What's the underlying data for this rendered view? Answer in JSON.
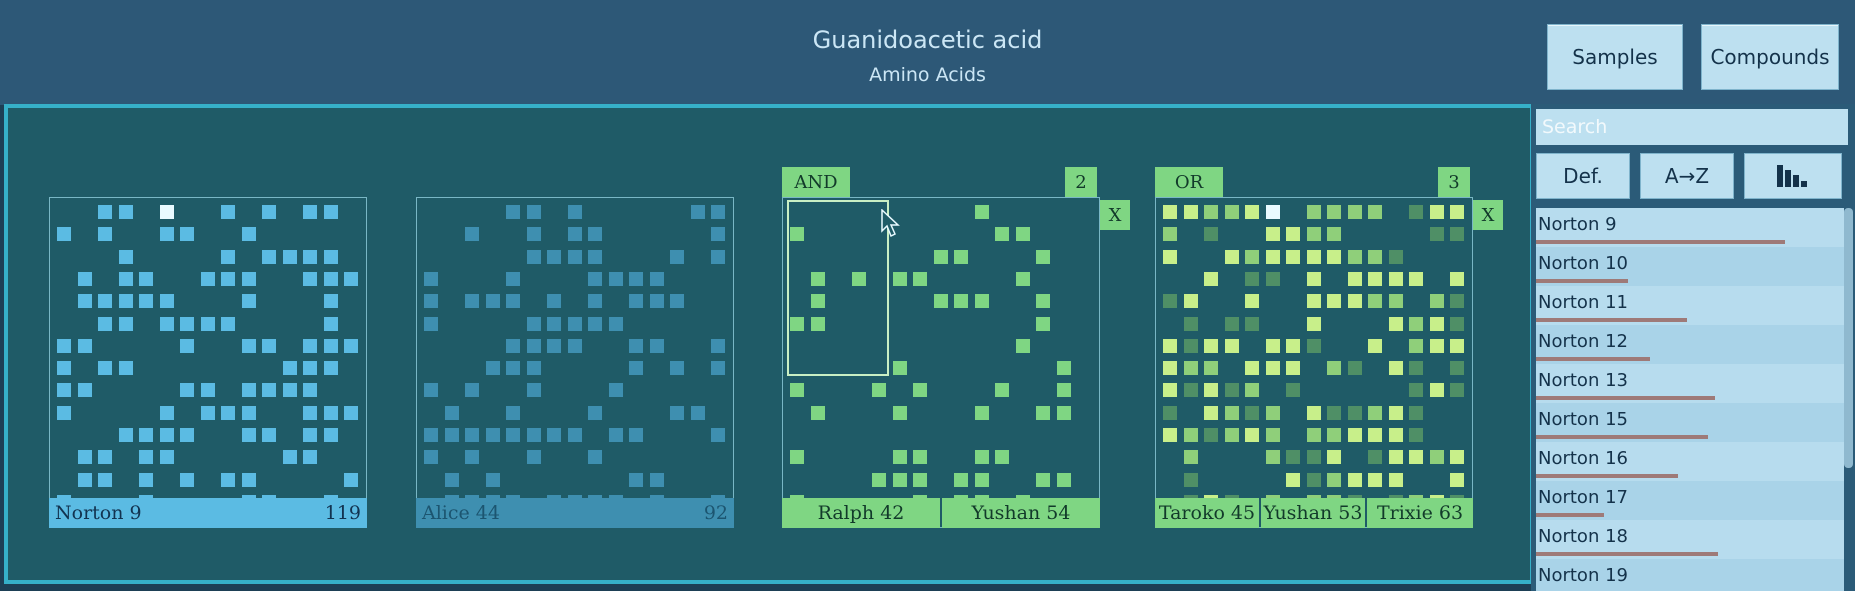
{
  "header": {
    "title": "Guanidoacetic acid",
    "subtitle": "Amino Acids"
  },
  "toolbar": {
    "samples_label": "Samples",
    "compounds_label": "Compounds"
  },
  "colors": {
    "blue": "#5bbbe3",
    "blue_dim": "#3e8fb0",
    "green": "#7fd683",
    "yellow": "#c8ef8a",
    "highlight": "#e9faff"
  },
  "panels": [
    {
      "samples": [
        {
          "name": "Norton 9",
          "count": "119"
        }
      ]
    },
    {
      "samples": [
        {
          "name": "Alice 44",
          "count": "92"
        }
      ]
    },
    {
      "op": "AND",
      "count": "2",
      "close": "X",
      "samples": [
        {
          "name": "Ralph 42"
        },
        {
          "name": "Yushan 54"
        }
      ]
    },
    {
      "op": "OR",
      "count": "3",
      "close": "X",
      "samples": [
        {
          "name": "Taroko 45"
        },
        {
          "name": "Yushan 53"
        },
        {
          "name": "Trixie 63"
        }
      ]
    }
  ],
  "sidebar": {
    "search_placeholder": "Search",
    "sort_default": "Def.",
    "sort_az": "A→Z",
    "sort_bars_icon": "bar-chart-icon",
    "items": [
      {
        "label": "Norton 9",
        "value": 0.81
      },
      {
        "label": "Norton 10",
        "value": 0.3
      },
      {
        "label": "Norton 11",
        "value": 0.49
      },
      {
        "label": "Norton 12",
        "value": 0.37
      },
      {
        "label": "Norton 13",
        "value": 0.58
      },
      {
        "label": "Norton 15",
        "value": 0.56
      },
      {
        "label": "Norton 16",
        "value": 0.46
      },
      {
        "label": "Norton 17",
        "value": 0.22
      },
      {
        "label": "Norton 18",
        "value": 0.59
      },
      {
        "label": "Norton 19",
        "value": 0.0
      }
    ]
  }
}
